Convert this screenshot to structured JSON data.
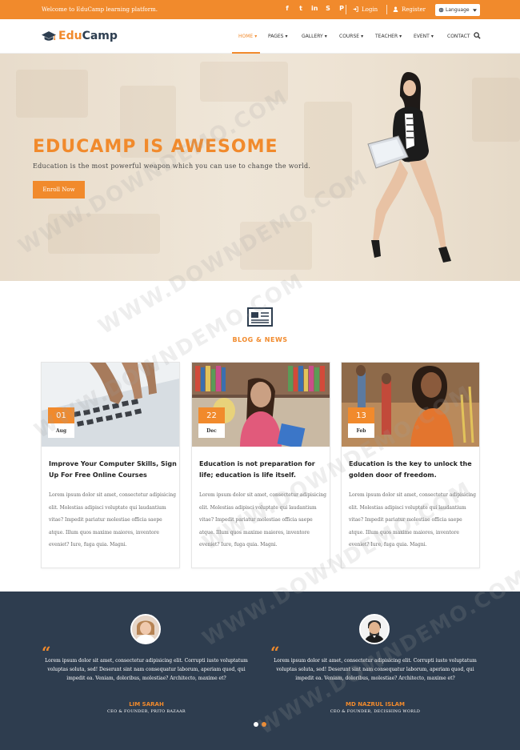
{
  "topbar": {
    "welcome": "Welcome to EduCamp learning platform.",
    "social": [
      {
        "icon": "facebook-icon",
        "glyph": "f"
      },
      {
        "icon": "twitter-icon",
        "glyph": "t"
      },
      {
        "icon": "linkedin-icon",
        "glyph": "in"
      },
      {
        "icon": "skype-icon",
        "glyph": "S"
      },
      {
        "icon": "pinterest-icon",
        "glyph": "P"
      }
    ],
    "login_label": "Login",
    "register_label": "Register",
    "language_label": "Language"
  },
  "brand": {
    "edu": "Edu",
    "camp": "Camp"
  },
  "menu": [
    {
      "label": "HOME",
      "active": true
    },
    {
      "label": "PAGES",
      "active": false
    },
    {
      "label": "GALLERY",
      "active": false
    },
    {
      "label": "COURSE",
      "active": false
    },
    {
      "label": "TEACHER",
      "active": false
    },
    {
      "label": "EVENT",
      "active": false
    },
    {
      "label": "CONTACT",
      "active": false
    }
  ],
  "hero": {
    "title": "EDUCAMP IS AWESOME",
    "subtitle": "Education is the most powerful weapon which you can use to change the world.",
    "button": "Enroll Now"
  },
  "blog": {
    "heading": "BLOG & NEWS",
    "posts": [
      {
        "day": "01",
        "month": "Aug",
        "title": "Improve Your Computer Skills, Sign Up For Free Online Courses",
        "excerpt": "Lorem ipsum dolor sit amet, consectetur adipisicing elit. Molestias adipisci voluptate qui laudantium vitae? Impedit pariatur molestiae officia saepe atque. Illum quos maxime maiores, inventore eveniet? Iure, fuga quia. Magni."
      },
      {
        "day": "22",
        "month": "Dec",
        "title": "Education is not preparation for life; education is life itself.",
        "excerpt": "Lorem ipsum dolor sit amet, consectetur adipisicing elit. Molestias adipisci voluptate qui laudantium vitae? Impedit pariatur molestiae officia saepe atque. Illum quos maxime maiores, inventore eveniet? Iure, fuga quia. Magni."
      },
      {
        "day": "13",
        "month": "Feb",
        "title": "Education is the key to unlock the golden door of freedom.",
        "excerpt": "Lorem ipsum dolor sit amet, consectetur adipisicing elit. Molestias adipisci voluptate qui laudantium vitae? Impedit pariatur molestiae officia saepe atque. Illum quos maxime maiores, inventore eveniet? Iure, fuga quia. Magni."
      }
    ]
  },
  "testimonials": [
    {
      "text": "Lorem ipsum dolor sit amet, consectetur adipisicing elit. Corrupti iusto voluptatum voluptas soluta, sed! Deserunt sint nam consequatur laborum, aperiam quod, qui impedit ea. Veniam, doloribus, molestiae? Architecto, maxime et?",
      "name": "LIM SARAH",
      "role": "CEO & FOUNDER, PRITO BAZAAR"
    },
    {
      "text": "Lorem ipsum dolor sit amet, consectetur adipisicing elit. Corrupti iusto voluptatum voluptas soluta, sed! Deserunt sint nam consequatur laborum, aperiam quod, qui impedit ea. Veniam, doloribus, molestiae? Architecto, maxime et?",
      "name": "MD NAZRUL ISLAM",
      "role": "CEO & FOUNDER, DECISHING WORLD"
    }
  ],
  "watermark": "WWW.DOWNDEMO.COM",
  "colors": {
    "accent": "#f18a2c",
    "dark": "#2e3d4f"
  }
}
